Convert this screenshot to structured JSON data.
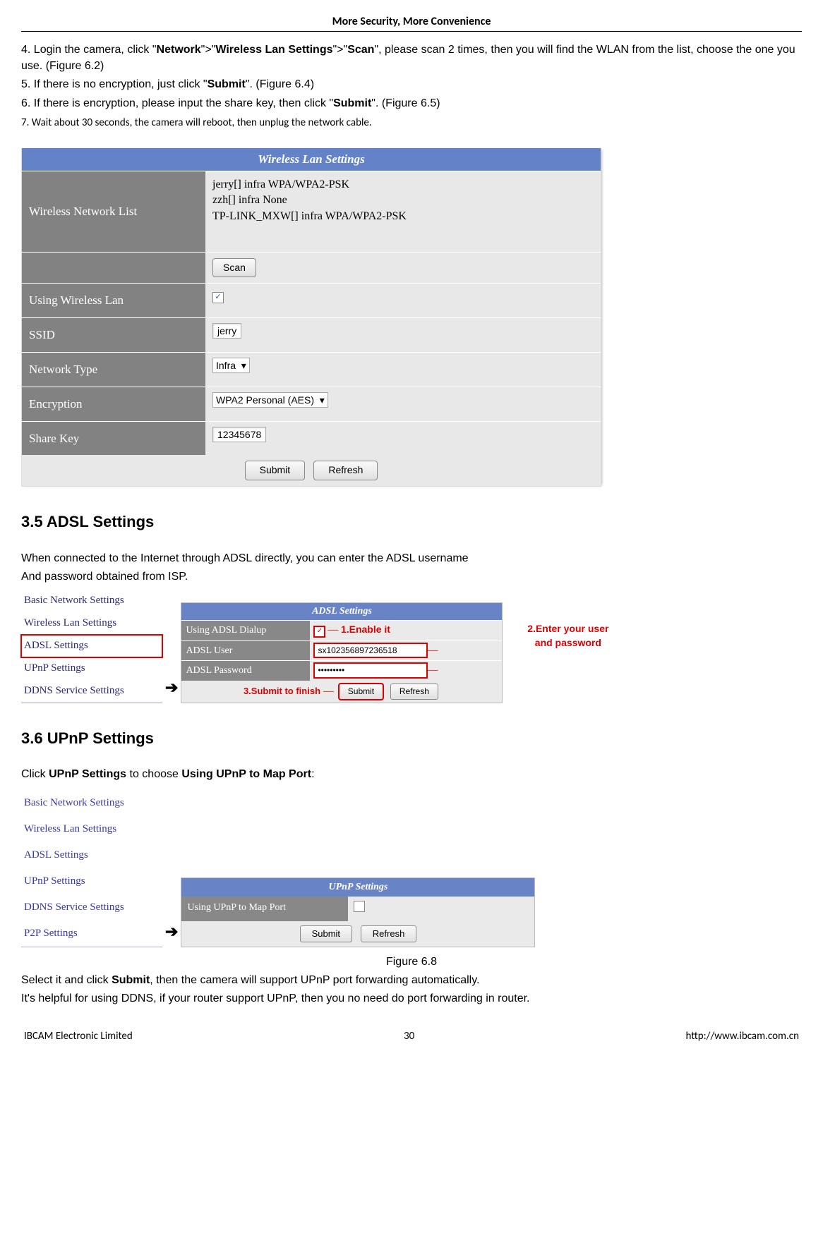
{
  "header": {
    "title": "More Security, More Convenience"
  },
  "instructions": {
    "i4_pre": "4. Login the camera, click \"",
    "i4_b1": "Network",
    "i4_mid1": "\">\"",
    "i4_b2": "Wireless Lan Settings",
    "i4_mid2": "\">\"",
    "i4_b3": "Scan",
    "i4_post": "\", please scan 2 times, then you will find the WLAN from the list, choose the one you use. (Figure 6.2)",
    "i5_pre": "5. If there is no encryption, just click \"",
    "i5_b": "Submit",
    "i5_post": "\".    (Figure 6.4)",
    "i6_pre": "6. If there is encryption, please input the share key, then click \"",
    "i6_b": "Submit",
    "i6_post": "\". (Figure 6.5)",
    "i7": "7. Wait about 30 seconds, the camera will reboot, then unplug the network cable."
  },
  "wireless": {
    "title": "Wireless Lan Settings",
    "list_label": "Wireless Network List",
    "networks": {
      "n1": "jerry[] infra WPA/WPA2-PSK",
      "n2": "zzh[] infra None",
      "n3": "TP-LINK_MXW[] infra WPA/WPA2-PSK"
    },
    "scan": "Scan",
    "using_label": "Using Wireless Lan",
    "using_checked": "✓",
    "ssid_label": "SSID",
    "ssid_value": "jerry",
    "nettype_label": "Network Type",
    "nettype_value": "Infra",
    "enc_label": "Encryption",
    "enc_value": "WPA2 Personal (AES)",
    "key_label": "Share Key",
    "key_value": "12345678",
    "submit": "Submit",
    "refresh": "Refresh"
  },
  "section35": {
    "heading": "3.5 ADSL Settings",
    "p1": "When connected to the Internet through ADSL directly, you can enter the ADSL username",
    "p2": "And password obtained from ISP."
  },
  "adsl_nav": {
    "n1": "Basic Network Settings",
    "n2": "Wireless Lan Settings",
    "n3": "ADSL Settings",
    "n4": "UPnP Settings",
    "n5": "DDNS Service Settings"
  },
  "adsl": {
    "title": "ADSL Settings",
    "row1_label": "Using ADSL Dialup",
    "row1_check": "✓",
    "note1": "1.Enable it",
    "row2_label": "ADSL User",
    "row2_value": "sx102356897236518",
    "row3_label": "ADSL Password",
    "row3_value": "•••••••••",
    "note2a": "2.Enter your user",
    "note2b": "and password",
    "note3": "3.Submit to finish",
    "submit": "Submit",
    "refresh": "Refresh"
  },
  "section36": {
    "heading": "3.6 UPnP Settings",
    "p_pre": "Click ",
    "p_b1": "UPnP Settings",
    "p_mid": " to choose ",
    "p_b2": "Using UPnP to Map Port",
    "p_post": ":"
  },
  "upnp_nav": {
    "n1": "Basic Network Settings",
    "n2": "Wireless Lan Settings",
    "n3": "ADSL Settings",
    "n4": "UPnP Settings",
    "n5": "DDNS Service Settings",
    "n6": "P2P Settings"
  },
  "upnp": {
    "title": "UPnP Settings",
    "row_label": "Using UPnP to Map Port",
    "submit": "Submit",
    "refresh": "Refresh"
  },
  "fig68": "Figure 6.8",
  "closing": {
    "l1_pre": "Select it and click ",
    "l1_b": "Submit",
    "l1_post": ", then the camera will support UPnP port forwarding automatically.",
    "l2": "It's helpful for using DDNS, if your router support UPnP, then you no need do port forwarding in router."
  },
  "footer": {
    "left": "IBCAM Electronic Limited",
    "mid": "30",
    "right": "http://www.ibcam.com.cn"
  },
  "arrow": "➔"
}
